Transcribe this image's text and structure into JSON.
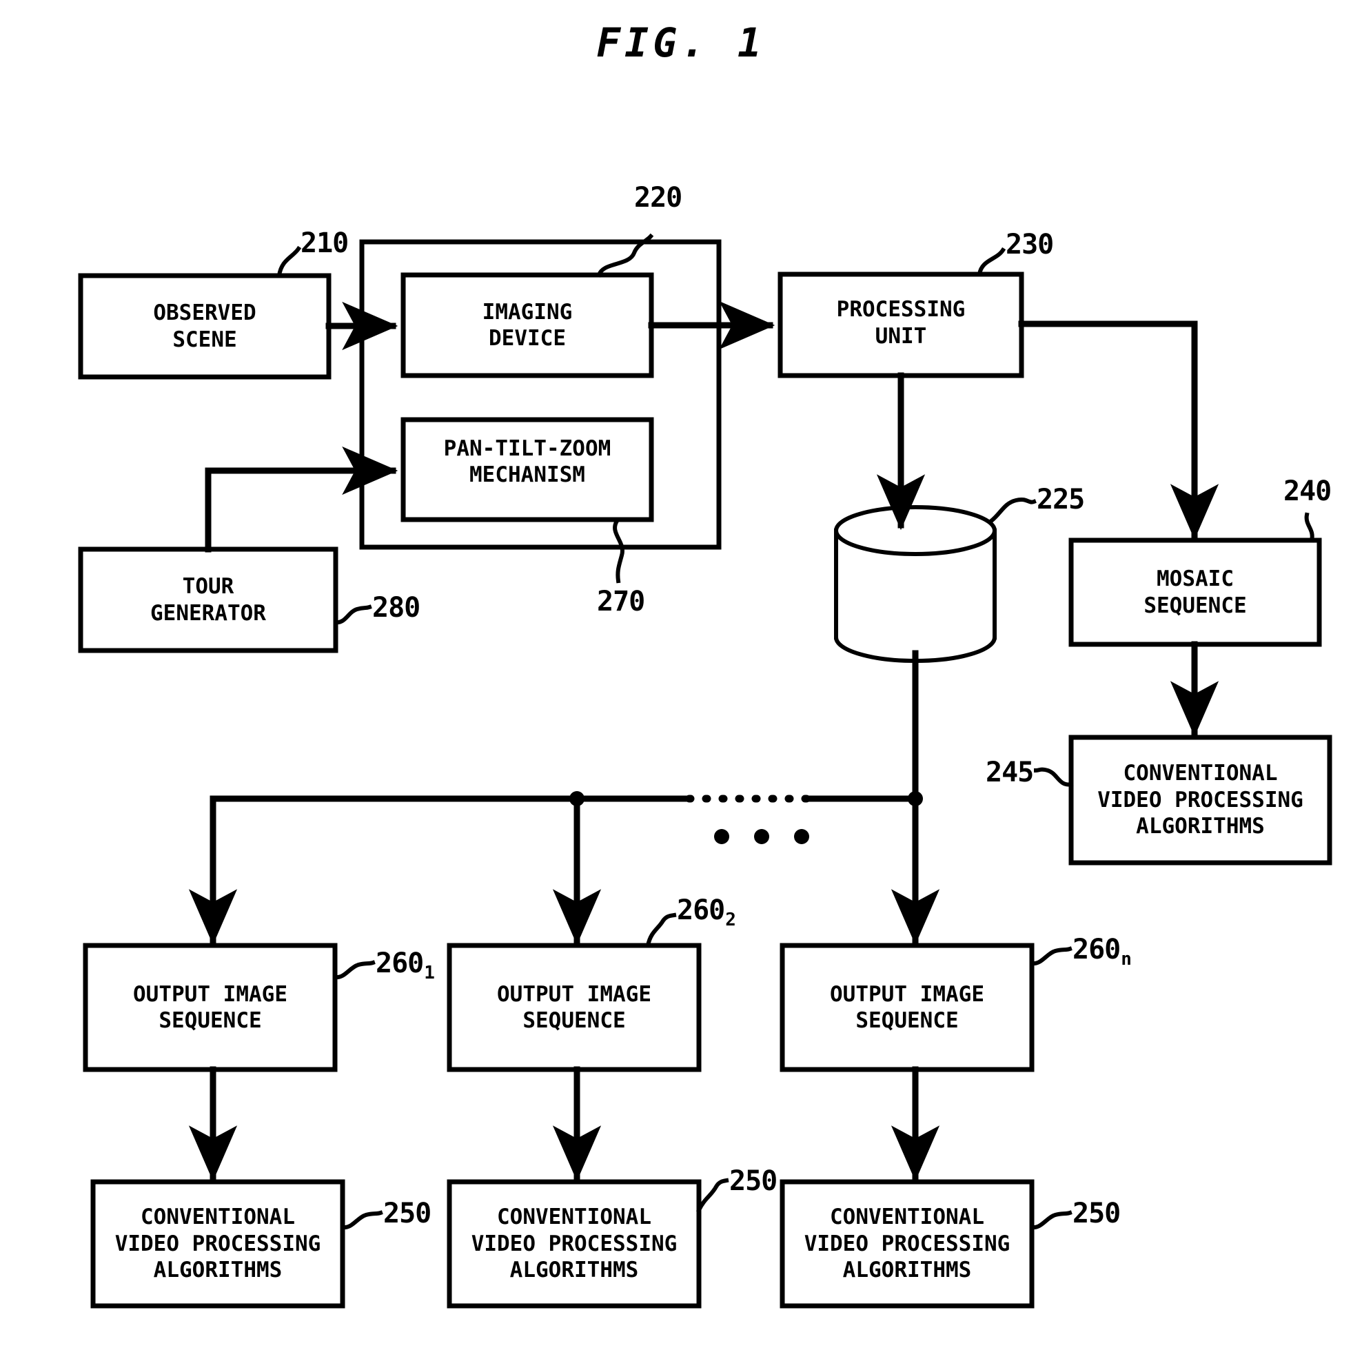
{
  "figure": {
    "title": "FIG. 1",
    "type": "patent-block-diagram"
  },
  "boxes": {
    "observed_scene": {
      "line1": "OBSERVED",
      "line2": "SCENE"
    },
    "imaging_device": {
      "line1": "IMAGING",
      "line2": "DEVICE"
    },
    "pan_tilt_zoom": {
      "line1": "PAN-TILT-ZOOM",
      "line2": "MECHANISM"
    },
    "tour_generator": {
      "line1": "TOUR",
      "line2": "GENERATOR"
    },
    "processing_unit": {
      "line1": "PROCESSING",
      "line2": "UNIT"
    },
    "mosaic_sequence": {
      "line1": "MOSAIC",
      "line2": "SEQUENCE"
    },
    "cvpa_mosaic": {
      "line1": "CONVENTIONAL",
      "line2": "VIDEO PROCESSING",
      "line3": "ALGORITHMS"
    },
    "output_image_seq_1": {
      "line1": "OUTPUT IMAGE",
      "line2": "SEQUENCE"
    },
    "output_image_seq_2": {
      "line1": "OUTPUT IMAGE",
      "line2": "SEQUENCE"
    },
    "output_image_seq_n": {
      "line1": "OUTPUT IMAGE",
      "line2": "SEQUENCE"
    },
    "cvpa_1": {
      "line1": "CONVENTIONAL",
      "line2": "VIDEO PROCESSING",
      "line3": "ALGORITHMS"
    },
    "cvpa_2": {
      "line1": "CONVENTIONAL",
      "line2": "VIDEO PROCESSING",
      "line3": "ALGORITHMS"
    },
    "cvpa_n": {
      "line1": "CONVENTIONAL",
      "line2": "VIDEO PROCESSING",
      "line3": "ALGORITHMS"
    }
  },
  "reference_numerals": {
    "observed_scene": "210",
    "imaging_device": "220",
    "processing_unit": "230",
    "storage_cylinder": "225",
    "mosaic_sequence": "240",
    "cvpa_mosaic": "245",
    "camera_assembly": "270",
    "tour_generator": "280",
    "output_image_seq_1_base": "260",
    "output_image_seq_1_sub": "1",
    "output_image_seq_2_base": "260",
    "output_image_seq_2_sub": "2",
    "output_image_seq_n_base": "260",
    "output_image_seq_n_sub": "n",
    "cvpa_1": "250",
    "cvpa_2": "250",
    "cvpa_n": "250"
  },
  "colors": {
    "ink": "#000000",
    "paper": "#ffffff"
  },
  "elements": {
    "storage_cylinder_name": "database-cylinder",
    "ellipsis_horizontal": "dotted-bus-continuation",
    "ellipsis_dots": "three-dot-ellipsis"
  }
}
